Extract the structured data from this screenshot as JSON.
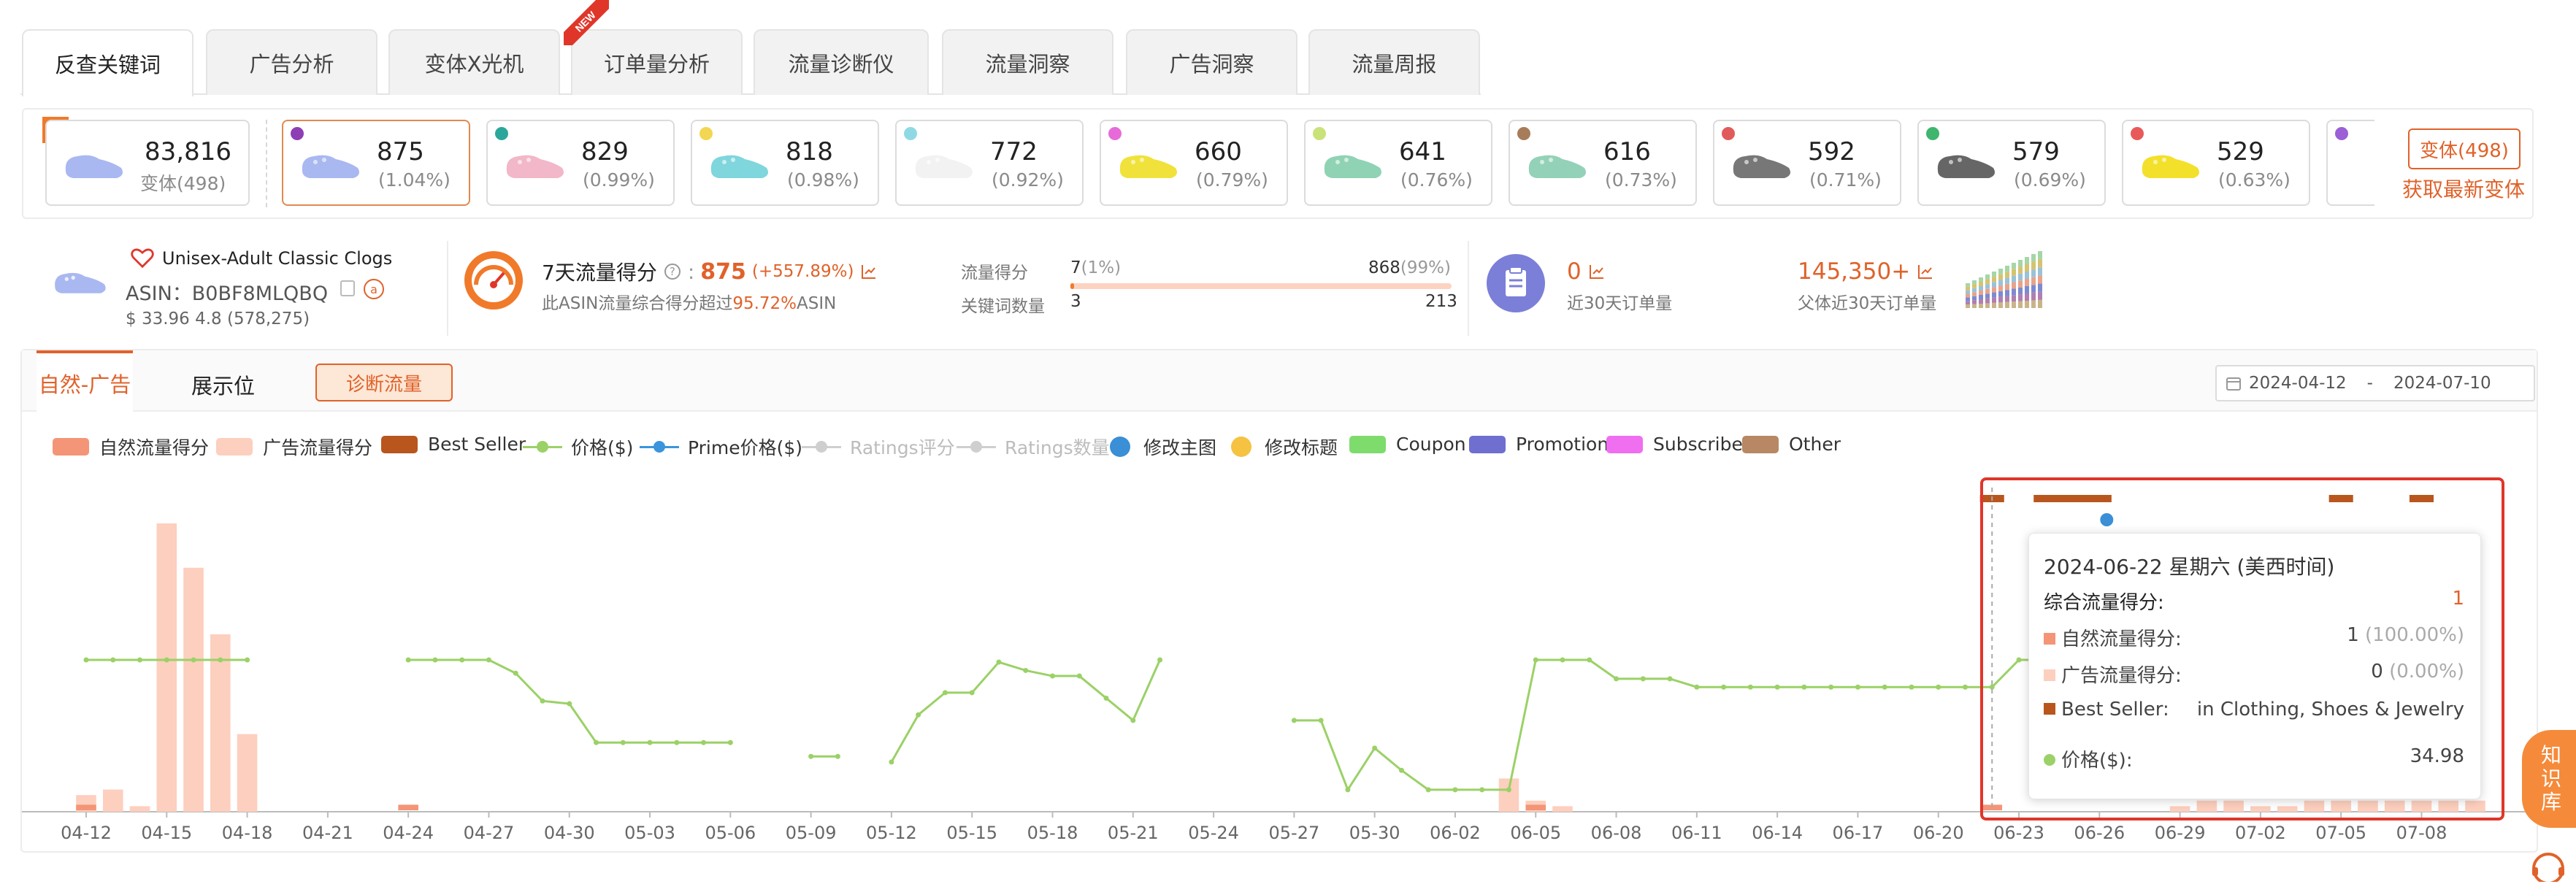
{
  "tabs": [
    {
      "label": "反查关键词",
      "active": true
    },
    {
      "label": "广告分析"
    },
    {
      "label": "变体X光机"
    },
    {
      "label": "订单量分析",
      "badge": "NEW"
    },
    {
      "label": "流量诊断仪"
    },
    {
      "label": "流量洞察"
    },
    {
      "label": "广告洞察"
    },
    {
      "label": "流量周报"
    }
  ],
  "variants": {
    "parent_badge": "父",
    "parent": {
      "value": "83,816",
      "sub": "变体(498)"
    },
    "items": [
      {
        "value": "875",
        "pct": "(1.04%)",
        "dot": "#8e3fb4",
        "color": "#a9b8f0",
        "selected": true
      },
      {
        "value": "829",
        "pct": "(0.99%)",
        "dot": "#2aa79a",
        "color": "#f2b7c8"
      },
      {
        "value": "818",
        "pct": "(0.98%)",
        "dot": "#f3d651",
        "color": "#7fd6dc"
      },
      {
        "value": "772",
        "pct": "(0.92%)",
        "dot": "#8fd9e4",
        "color": "#f2f2f2"
      },
      {
        "value": "660",
        "pct": "(0.79%)",
        "dot": "#e66bd9",
        "color": "#f0e23a"
      },
      {
        "value": "641",
        "pct": "(0.76%)",
        "dot": "#c9e27a",
        "color": "#8fd3b4"
      },
      {
        "value": "616",
        "pct": "(0.73%)",
        "dot": "#a67c5a",
        "color": "#94d1b9"
      },
      {
        "value": "592",
        "pct": "(0.71%)",
        "dot": "#e25b5b",
        "color": "#777777"
      },
      {
        "value": "579",
        "pct": "(0.69%)",
        "dot": "#3fb56e",
        "color": "#666666"
      },
      {
        "value": "529",
        "pct": "(0.63%)",
        "dot": "#e85a5a",
        "color": "#f3e02a"
      }
    ],
    "variant_button": "变体(498)",
    "fetch_link": "获取最新变体"
  },
  "product": {
    "title": "Unisex-Adult Classic Clogs",
    "asin_label": "ASIN：",
    "asin": "B0BF8MLQBQ",
    "price_rating": "$ 33.96 4.8 (578,275)"
  },
  "score": {
    "label": "7天流量得分",
    "value": "875",
    "change": "(+557.89%)",
    "desc_prefix": "此ASIN流量综合得分超过",
    "desc_pct": "95.72%",
    "desc_suffix": "ASIN",
    "traffic_label": "流量得分",
    "traffic_left": "7",
    "traffic_left_pct": "(1%)",
    "traffic_right": "868",
    "traffic_right_pct": "(99%)",
    "traffic_fill": 0.01,
    "keywords_label": "关键词数量",
    "keywords_left": "3",
    "keywords_right": "213"
  },
  "orders": {
    "value": "0",
    "label": "近30天订单量",
    "parent_value": "145,350+",
    "parent_label": "父体近30天订单量"
  },
  "chart_tabs": {
    "natural_ad": "自然-广告",
    "placement": "展示位",
    "diagnose_button": "诊断流量"
  },
  "date_range": {
    "start": "2024-04-12",
    "sep": "-",
    "end": "2024-07-10"
  },
  "legend": [
    {
      "label": "自然流量得分",
      "kind": "swatch",
      "color": "#f49577"
    },
    {
      "label": "广告流量得分",
      "kind": "swatch",
      "color": "#fdcfbe"
    },
    {
      "label": "Best Seller",
      "kind": "swatch",
      "color": "#b8561e"
    },
    {
      "label": "价格($)",
      "kind": "line",
      "color": "#9bd167"
    },
    {
      "label": "Prime价格($)",
      "kind": "line",
      "color": "#3a95dc"
    },
    {
      "label": "Ratings评分",
      "kind": "line",
      "color": "#cfcfcf",
      "dim": true
    },
    {
      "label": "Ratings数量",
      "kind": "line",
      "color": "#cfcfcf",
      "dim": true
    },
    {
      "label": "修改主图",
      "kind": "circle",
      "color": "#3a8fd6"
    },
    {
      "label": "修改标题",
      "kind": "circle",
      "color": "#f5c242"
    },
    {
      "label": "Coupon",
      "kind": "swatch",
      "color": "#7edc6d"
    },
    {
      "label": "Promotion",
      "kind": "swatch",
      "color": "#6e6fcf"
    },
    {
      "label": "Subscribe",
      "kind": "swatch",
      "color": "#ef6ff0"
    },
    {
      "label": "Other",
      "kind": "swatch",
      "color": "#b78863"
    }
  ],
  "chart_data": {
    "type": "bar",
    "x": [
      "04-12",
      "04-13",
      "04-14",
      "04-15",
      "04-16",
      "04-17",
      "04-18",
      "04-19",
      "04-20",
      "04-21",
      "04-22",
      "04-23",
      "04-24",
      "04-25",
      "04-26",
      "04-27",
      "04-28",
      "04-29",
      "04-30",
      "05-01",
      "05-02",
      "05-03",
      "05-04",
      "05-05",
      "05-06",
      "05-07",
      "05-08",
      "05-09",
      "05-10",
      "05-11",
      "05-12",
      "05-13",
      "05-14",
      "05-15",
      "05-16",
      "05-17",
      "05-18",
      "05-19",
      "05-20",
      "05-21",
      "05-22",
      "05-23",
      "05-24",
      "05-25",
      "05-26",
      "05-27",
      "05-28",
      "05-29",
      "05-30",
      "05-31",
      "06-01",
      "06-02",
      "06-03",
      "06-04",
      "06-05",
      "06-06",
      "06-07",
      "06-08",
      "06-09",
      "06-10",
      "06-11",
      "06-12",
      "06-13",
      "06-14",
      "06-15",
      "06-16",
      "06-17",
      "06-18",
      "06-19",
      "06-20",
      "06-21",
      "06-22",
      "06-23",
      "06-24",
      "06-25",
      "06-26",
      "06-27",
      "06-28",
      "06-29",
      "06-30",
      "07-01",
      "07-02",
      "07-03",
      "07-04",
      "07-05",
      "07-06",
      "07-07",
      "07-08",
      "07-09",
      "07-10"
    ],
    "tick_labels": [
      "04-12",
      "04-15",
      "04-18",
      "04-21",
      "04-24",
      "04-27",
      "04-30",
      "05-03",
      "05-06",
      "05-09",
      "05-12",
      "05-15",
      "05-18",
      "05-21",
      "05-24",
      "05-27",
      "05-30",
      "06-02",
      "06-05",
      "06-08",
      "06-11",
      "06-14",
      "06-17",
      "06-20",
      "06-23",
      "06-26",
      "06-29",
      "07-02",
      "07-05",
      "07-08"
    ],
    "series": [
      {
        "name": "自然流量得分",
        "values": [
          1,
          0,
          0,
          0,
          0,
          0,
          0,
          0,
          0,
          0,
          0,
          0,
          1,
          0,
          0,
          0,
          0,
          0,
          0,
          0,
          0,
          0,
          0,
          0,
          0,
          0,
          0,
          0,
          0,
          0,
          0,
          0,
          0,
          0,
          0,
          0,
          0,
          0,
          0,
          0,
          0,
          0,
          0,
          0,
          0,
          0,
          0,
          0,
          0,
          0,
          0,
          0,
          0,
          0,
          1,
          0,
          0,
          0,
          0,
          0,
          0,
          0,
          0,
          0,
          0,
          0,
          0,
          0,
          0,
          0,
          0,
          1,
          0,
          0,
          0,
          0,
          0,
          0,
          0,
          0,
          0,
          0,
          0,
          0,
          0,
          0,
          0,
          0,
          0,
          0
        ]
      },
      {
        "name": "广告流量得分",
        "values": [
          3,
          4,
          1,
          52,
          44,
          32,
          14,
          0,
          0,
          0,
          0,
          0,
          0,
          0,
          0,
          0,
          0,
          0,
          0,
          0,
          0,
          0,
          0,
          0,
          0,
          0,
          0,
          0,
          0,
          0,
          0,
          0,
          0,
          0,
          0,
          0,
          0,
          0,
          0,
          0,
          0,
          0,
          0,
          0,
          0,
          0,
          0,
          0,
          0,
          0,
          0,
          0,
          0,
          6,
          2,
          1,
          0,
          0,
          0,
          0,
          0,
          0,
          0,
          0,
          0,
          0,
          0,
          0,
          0,
          0,
          0,
          0,
          0,
          0,
          0,
          0,
          0,
          0,
          1,
          2,
          2,
          1,
          1,
          2,
          2,
          2,
          2,
          2,
          2,
          2
        ]
      },
      {
        "name": "价格($)",
        "values": [
          34.98,
          34.98,
          34.98,
          34.98,
          34.98,
          34.98,
          34.98,
          null,
          null,
          null,
          null,
          null,
          34.98,
          34.98,
          34.98,
          34.98,
          34.5,
          33.5,
          33.4,
          32.0,
          32.0,
          32.0,
          32.0,
          32.0,
          32.0,
          null,
          null,
          31.5,
          31.5,
          null,
          31.3,
          33.0,
          33.8,
          33.8,
          34.9,
          34.6,
          34.4,
          34.4,
          33.6,
          32.8,
          34.98,
          null,
          null,
          null,
          null,
          32.8,
          32.8,
          30.3,
          31.8,
          31.0,
          30.3,
          30.3,
          30.3,
          30.3,
          34.98,
          34.98,
          34.98,
          34.3,
          34.3,
          34.3,
          34.0,
          34.0,
          34.0,
          34.0,
          34.0,
          34.0,
          34.0,
          34.0,
          34.0,
          34.0,
          34.0,
          34.0,
          34.98,
          34.98,
          34.98,
          34.98,
          34.98,
          34.98,
          34.98,
          34.98,
          34.98,
          34.98,
          34.98,
          34.98,
          34.98,
          34.98,
          34.98,
          34.98,
          34.98,
          34.98
        ]
      }
    ],
    "best_seller_ranges": [
      [
        "06-22",
        "06-22"
      ],
      [
        "06-24",
        "06-26"
      ],
      [
        "07-05",
        "07-05"
      ],
      [
        "07-08",
        "07-08"
      ]
    ],
    "main_image_change": [
      "06-26"
    ]
  },
  "tooltip": {
    "date": "2024-06-22 星期六 (美西时间)",
    "total_label": "综合流量得分:",
    "total_value": "1",
    "natural_label": "自然流量得分:",
    "natural_value": "1",
    "natural_pct": "(100.00%)",
    "ad_label": "广告流量得分:",
    "ad_value": "0",
    "ad_pct": "(0.00%)",
    "bs_label": "Best Seller:",
    "bs_value": "in Clothing, Shoes & Jewelry",
    "price_label": "价格($):",
    "price_value": "34.98"
  },
  "knowledge_base": "知识库",
  "colors": {
    "accent": "#e0622a",
    "highlight_box": "#e0362a"
  }
}
